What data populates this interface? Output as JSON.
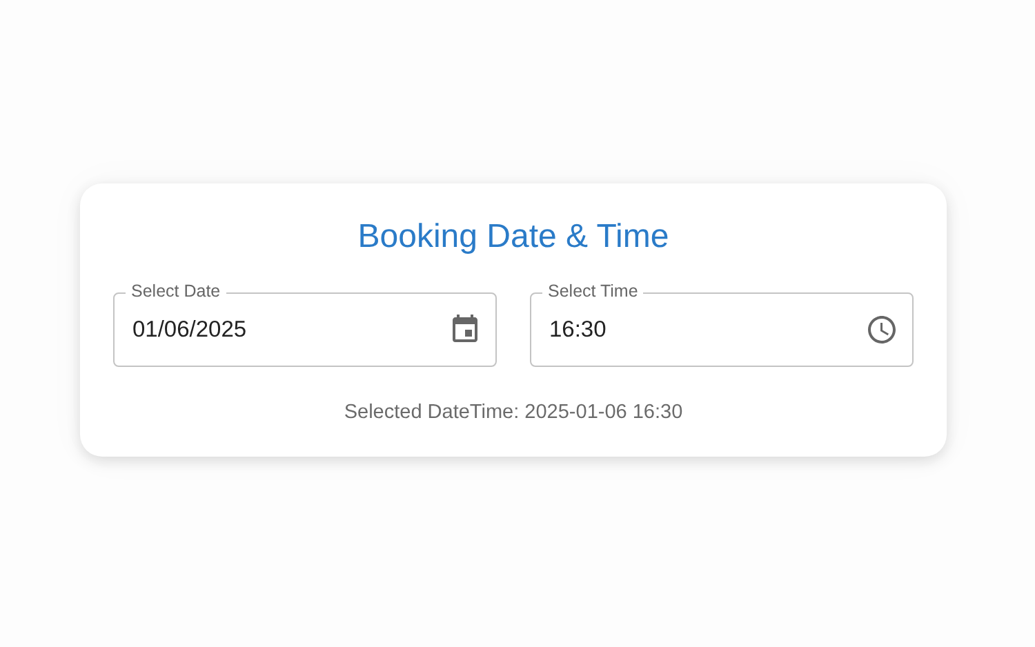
{
  "card": {
    "title": "Booking Date & Time",
    "fields": [
      {
        "kind": "date",
        "label": "Select Date",
        "value": "01/06/2025"
      },
      {
        "kind": "time",
        "label": "Select Time",
        "value": "16:30"
      }
    ],
    "result": "Selected DateTime: 2025-01-06 16:30"
  }
}
